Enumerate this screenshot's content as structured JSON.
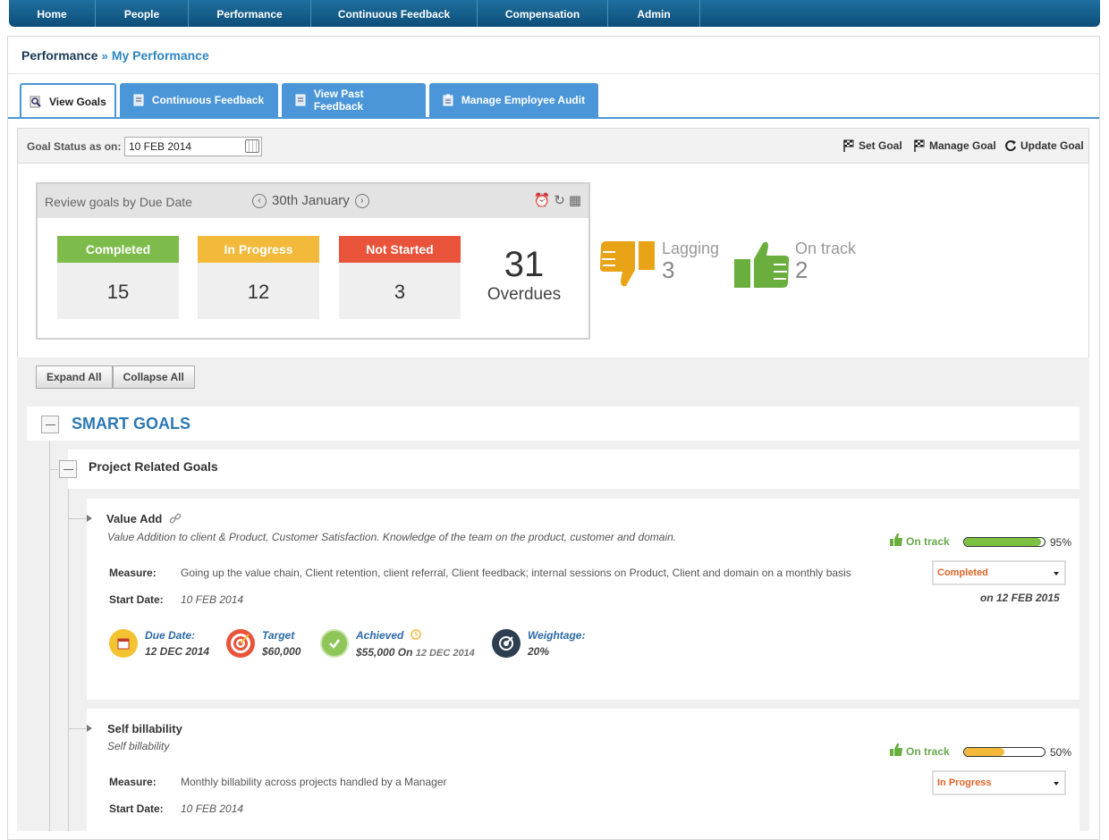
{
  "nav": {
    "items": [
      {
        "label": "Home"
      },
      {
        "label": "People"
      },
      {
        "label": "Performance"
      },
      {
        "label": "Continuous Feedback"
      },
      {
        "label": "Compensation"
      },
      {
        "label": "Admin"
      }
    ]
  },
  "breadcrumb": {
    "section": "Performance",
    "separator": "»",
    "page": "My Performance"
  },
  "tabs": [
    {
      "label": "View Goals",
      "icon": "magnifier-icon",
      "active": true
    },
    {
      "label": "Continuous Feedback",
      "icon": "document-icon",
      "active": false
    },
    {
      "label": "View Past Feedback",
      "icon": "document-icon",
      "active": false
    },
    {
      "label": "Manage Employee Audit",
      "icon": "clipboard-icon",
      "active": false
    }
  ],
  "status_bar": {
    "label": "Goal Status as on:",
    "date_value": "10 FEB 2014",
    "actions": {
      "set_goal": "Set Goal",
      "manage_goal": "Manage Goal",
      "update_goal": "Update Goal"
    }
  },
  "review": {
    "label": "Review goals by Due Date",
    "date": "30th January",
    "stats": {
      "completed": {
        "label": "Completed",
        "value": "15",
        "color": "#7dbb4a"
      },
      "in_progress": {
        "label": "In Progress",
        "value": "12",
        "color": "#f2b93b"
      },
      "not_started": {
        "label": "Not Started",
        "value": "3",
        "color": "#e9533a"
      }
    },
    "overdue": {
      "value": "31",
      "label": "Overdues"
    }
  },
  "indicators": {
    "lagging": {
      "label": "Lagging",
      "value": "3",
      "color": "#e8a317"
    },
    "on_track": {
      "label": "On track",
      "value": "2",
      "color": "#6aaf3e"
    }
  },
  "buttons": {
    "expand_all": "Expand All",
    "collapse_all": "Collapse All"
  },
  "smart_goals": {
    "title": "SMART GOALS"
  },
  "project_goals": {
    "title": "Project Related Goals"
  },
  "goals": [
    {
      "title": "Value Add",
      "description": "Value Addition to client & Product, Customer Satisfaction. Knowledge of the team on the product, customer and domain.",
      "measure_label": "Measure:",
      "measure": "Going up the value chain, Client retention, client referral, Client feedback; internal sessions on Product, Client and domain on a monthly basis",
      "start_label": "Start Date:",
      "start_date": "10 FEB 2014",
      "track_status": "On track",
      "progress": 0.95,
      "progress_text": "95%",
      "progress_color": "#7cc142",
      "status": "Completed",
      "status_date": "on 12 FEB 2015",
      "due_label": "Due Date:",
      "due_value": "12 DEC 2014",
      "target_label": "Target",
      "target_value": "$60,000",
      "achieved_label": "Achieved",
      "achieved_value": "$55,000",
      "achieved_on": "On",
      "achieved_date": "12 DEC 2014",
      "weightage_label": "Weightage:",
      "weightage_value": "20%"
    },
    {
      "title": "Self billability",
      "description": "Self billability",
      "measure_label": "Measure:",
      "measure": "Monthly billability across projects handled by a Manager",
      "start_label": "Start Date:",
      "start_date": "10 FEB 2014",
      "track_status": "On track",
      "progress": 0.5,
      "progress_text": "50%",
      "progress_color": "#f2b93b",
      "status": "In Progress"
    }
  ]
}
